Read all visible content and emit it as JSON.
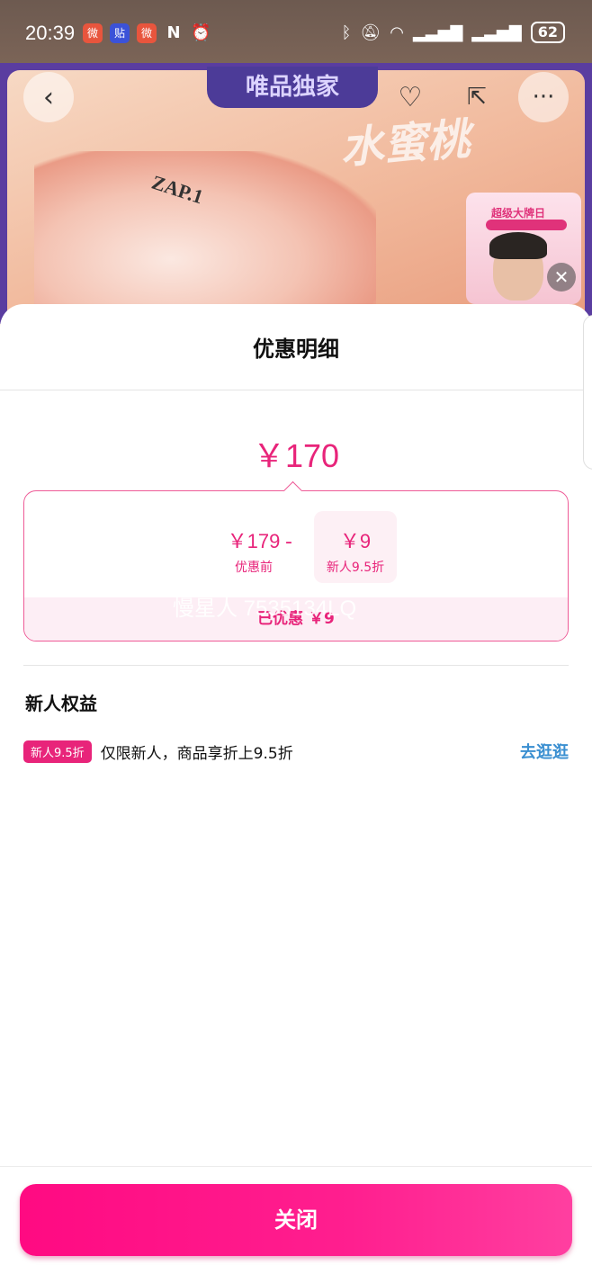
{
  "status_bar": {
    "time": "20:39",
    "apps": [
      {
        "icon": "weibo-icon",
        "color": "#e8553d",
        "glyph": "微"
      },
      {
        "icon": "tieba-icon",
        "color": "#3b52d8",
        "glyph": "贴"
      },
      {
        "icon": "weibo-icon",
        "color": "#e8553d",
        "glyph": "微"
      },
      {
        "icon": "nfc-icon",
        "color": "transparent",
        "glyph": "N"
      },
      {
        "icon": "alarm-icon",
        "color": "transparent",
        "glyph": "⏰"
      }
    ],
    "battery": "62"
  },
  "product": {
    "exclusive_label": "唯品独家",
    "promo_title": "水蜜桃",
    "shoe_logo": "ZAP.1",
    "live_title": "超级大牌日"
  },
  "sheet": {
    "title": "优惠明细",
    "total_price": "￥170",
    "original_price": "￥179",
    "original_label": "优惠前",
    "minus": "-",
    "discount_value": "￥9",
    "discount_label": "新人9.5折",
    "saved_text": "已优惠  ￥9",
    "watermark": "慢星人 7535134LQ",
    "section_title": "新人权益",
    "benefit": {
      "badge": "新人9.5折",
      "text": "仅限新人，商品享折上9.5折",
      "link": "去逛逛"
    },
    "close_button": "关闭"
  },
  "colors": {
    "accent": "#e8247a",
    "link": "#3a8fd1",
    "button": "#ff0a82"
  }
}
